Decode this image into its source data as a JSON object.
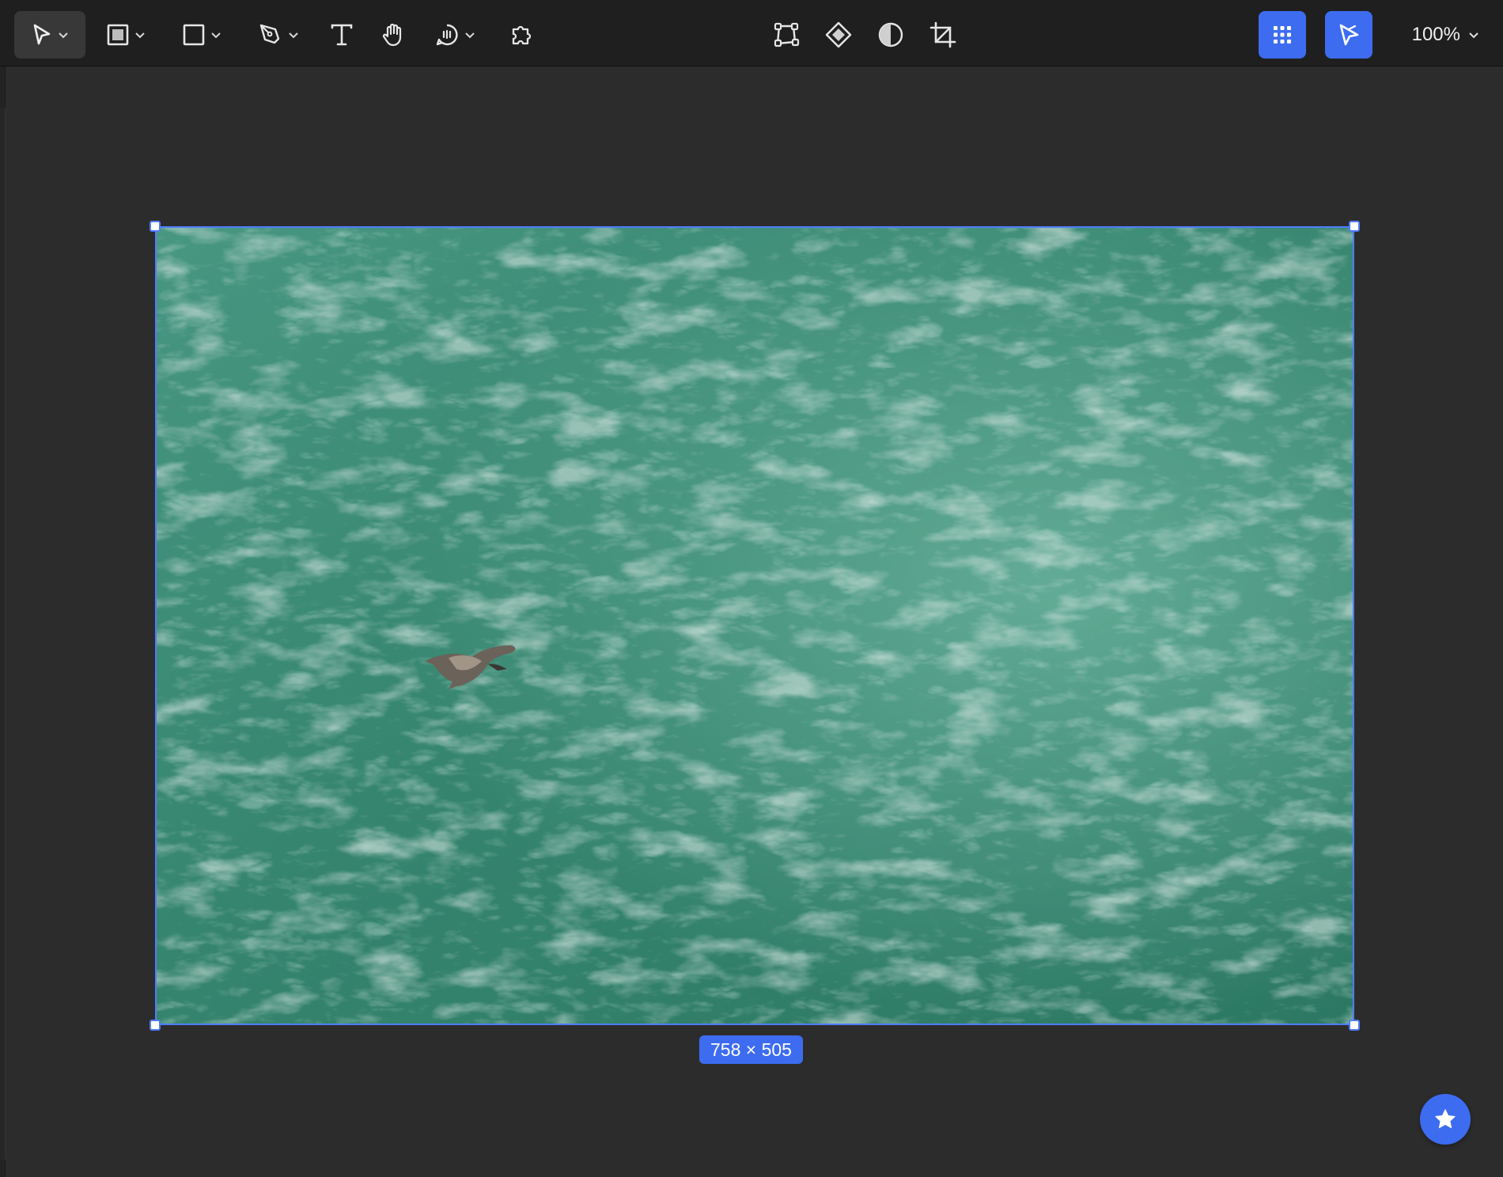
{
  "toolbar": {
    "tools_left": [
      {
        "name": "move-tool",
        "icon": "cursor-icon",
        "active": true,
        "has_menu": true
      },
      {
        "name": "frame-tool",
        "icon": "frame-icon",
        "has_menu": true
      },
      {
        "name": "shape-tool",
        "icon": "rectangle-icon",
        "has_menu": true
      },
      {
        "name": "pen-tool",
        "icon": "pen-icon",
        "has_menu": true
      },
      {
        "name": "text-tool",
        "icon": "text-icon"
      },
      {
        "name": "hand-tool",
        "icon": "hand-icon"
      },
      {
        "name": "comment-tool",
        "icon": "comment-icon",
        "has_menu": true
      },
      {
        "name": "plugins-tool",
        "icon": "puzzle-icon"
      }
    ],
    "tools_center": [
      {
        "name": "transform-tool",
        "icon": "transform-icon"
      },
      {
        "name": "component-tool",
        "icon": "diamond-icon"
      },
      {
        "name": "mask-tool",
        "icon": "half-circle-icon"
      },
      {
        "name": "crop-tool",
        "icon": "crop-icon"
      }
    ],
    "zoom_label": "100%"
  },
  "canvas": {
    "selection_size_label": "758 × 505"
  },
  "colors": {
    "accent": "#3d6cf0",
    "selection": "#4f7cff",
    "toolbar_bg": "#1f1f1f",
    "canvas_bg": "#2c2c2c",
    "water_dark": "#2f7f6a",
    "water_light": "#5fae98"
  }
}
